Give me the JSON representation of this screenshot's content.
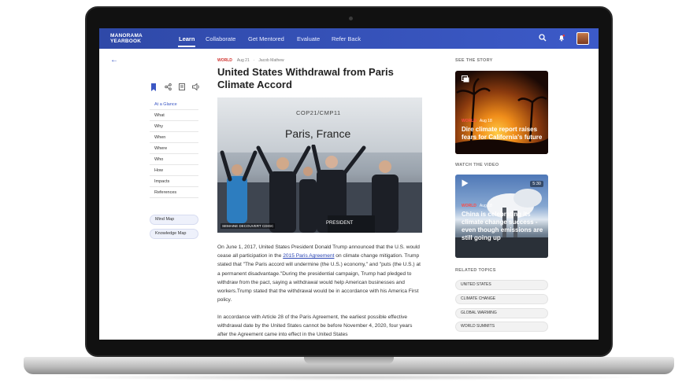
{
  "nav": {
    "logo_line1": "MANORAMA",
    "logo_line2": "YEARBOOK",
    "items": [
      {
        "label": "Learn",
        "active": true
      },
      {
        "label": "Collaborate"
      },
      {
        "label": "Get Mentored"
      },
      {
        "label": "Evaluate"
      },
      {
        "label": "Refer Back"
      }
    ],
    "icons": [
      "search-icon",
      "bell-icon",
      "avatar"
    ]
  },
  "sidebar": {
    "tool_icons": [
      "bookmark-icon",
      "share-icon",
      "notes-icon",
      "audio-icon"
    ],
    "toc": [
      "At a Glance",
      "What",
      "Why",
      "When",
      "Where",
      "Who",
      "How",
      "Impacts",
      "References"
    ],
    "buttons": [
      "Mind Map",
      "Knowledge Map"
    ]
  },
  "article": {
    "category": "WORLD",
    "date": "Aug 21",
    "author": "Jacob Mathew",
    "title": "United States Withdrawal from Paris Climate Accord",
    "image": {
      "caption": "COP21/CMP11",
      "title": "Paris, France",
      "stamp": "SEMAINE DECOUVERT CDIGC",
      "podium": "PRESIDENT"
    },
    "p1_a": "On June 1, 2017, United States President Donald Trump announced that the U.S. would cease all participation in the ",
    "p1_link": "2015 Paris Agreement",
    "p1_b": " on climate change mitigation. Trump stated that \"The Paris accord will undermine (the U.S.) economy,\" and \"puts (the U.S.) at a permanent disadvantage.\"During the presidential campaign, Trump had pledged to withdraw from the pact, saying a withdrawal would help American businesses and workers.Trump stated that the withdrawal would be in accordance with his America First policy.",
    "p2": "In accordance with Article 28 of the Paris Agreement, the earliest possible effective withdrawal date by the United States cannot be before November 4, 2020, four years after the Agreement came into effect in the United States"
  },
  "right": {
    "see_story_label": "SEE THE STORY",
    "story": {
      "category": "WORLD",
      "date": "Aug 18",
      "title": "Dire climate report raises fears for California's future"
    },
    "watch_label": "WATCH THE VIDEO",
    "video": {
      "category": "WORLD",
      "date": "Aug 18",
      "duration": "5:30",
      "title": "China is celebrating its climate change success - even though emissions are still going up"
    },
    "topics_label": "RELATED TOPICS",
    "topics": [
      "UNITED STATES",
      "CLIMATE CHANGE",
      "GLOBAL WARMING",
      "WORLD SUMMITS"
    ]
  },
  "colors": {
    "nav": "#3450b8",
    "accent": "#3b57c4",
    "category": "#d0312d"
  }
}
